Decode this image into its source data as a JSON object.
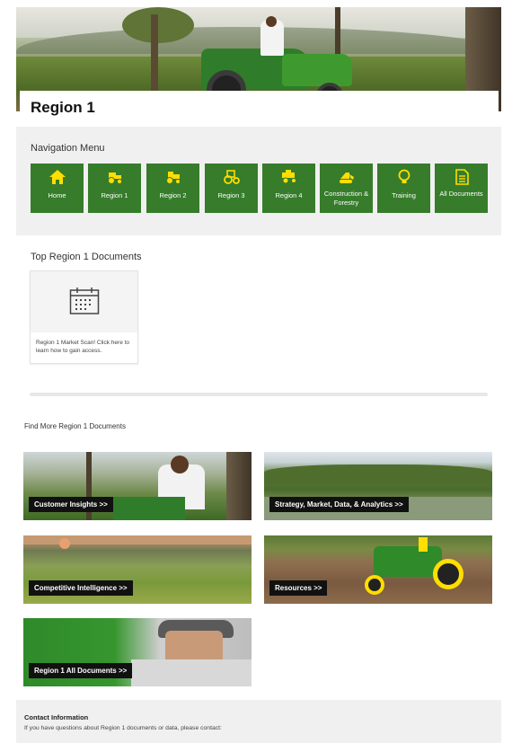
{
  "page": {
    "title": "Region 1"
  },
  "navigation": {
    "heading": "Navigation Menu",
    "items": [
      {
        "label": "Home",
        "icon": "home-icon"
      },
      {
        "label": "Region 1",
        "icon": "tractor-icon"
      },
      {
        "label": "Region 2",
        "icon": "tractor-icon"
      },
      {
        "label": "Region 3",
        "icon": "tractor-icon"
      },
      {
        "label": "Region 4",
        "icon": "harvester-icon"
      },
      {
        "label": "Construction & Forestry",
        "icon": "excavator-icon"
      },
      {
        "label": "Training",
        "icon": "lightbulb-icon"
      },
      {
        "label": "All Documents",
        "icon": "document-icon"
      }
    ]
  },
  "top_documents": {
    "heading": "Top Region 1 Documents",
    "cards": [
      {
        "description": "Region 1 Market Scan! Click here to learn how to gain access.",
        "icon": "calendar-icon"
      }
    ]
  },
  "find_more": {
    "heading": "Find More Region 1 Documents",
    "tiles": [
      {
        "label": "Customer Insights >>"
      },
      {
        "label": "Strategy, Market, Data, & Analytics >>"
      },
      {
        "label": "Competitive Intelligence >>"
      },
      {
        "label": "Resources >>"
      },
      {
        "label": "Region 1 All Documents >>"
      }
    ]
  },
  "contact": {
    "title": "Contact Information",
    "text": "If you have questions about Region 1 documents or data, please contact:"
  },
  "colors": {
    "brand_green": "#367c2b",
    "brand_yellow": "#ffde00",
    "section_gray": "#f0f0f0"
  }
}
